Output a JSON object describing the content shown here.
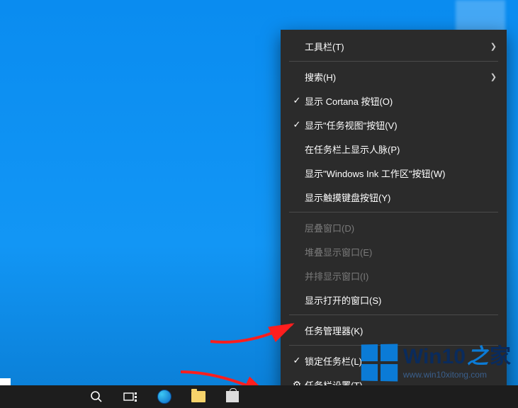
{
  "menu": {
    "items": [
      {
        "label": "工具栏(T)",
        "check": "",
        "hasSub": true,
        "disabled": false
      },
      {
        "sep": true
      },
      {
        "label": "搜索(H)",
        "check": "",
        "hasSub": true,
        "disabled": false
      },
      {
        "label": "显示 Cortana 按钮(O)",
        "check": "✓",
        "hasSub": false,
        "disabled": false
      },
      {
        "label": "显示\"任务视图\"按钮(V)",
        "check": "✓",
        "hasSub": false,
        "disabled": false
      },
      {
        "label": "在任务栏上显示人脉(P)",
        "check": "",
        "hasSub": false,
        "disabled": false
      },
      {
        "label": "显示\"Windows Ink 工作区\"按钮(W)",
        "check": "",
        "hasSub": false,
        "disabled": false
      },
      {
        "label": "显示触摸键盘按钮(Y)",
        "check": "",
        "hasSub": false,
        "disabled": false
      },
      {
        "sep": true
      },
      {
        "label": "层叠窗口(D)",
        "check": "",
        "hasSub": false,
        "disabled": true
      },
      {
        "label": "堆叠显示窗口(E)",
        "check": "",
        "hasSub": false,
        "disabled": true
      },
      {
        "label": "并排显示窗口(I)",
        "check": "",
        "hasSub": false,
        "disabled": true
      },
      {
        "label": "显示打开的窗口(S)",
        "check": "",
        "hasSub": false,
        "disabled": false
      },
      {
        "sep": true
      },
      {
        "label": "任务管理器(K)",
        "check": "",
        "hasSub": false,
        "disabled": false
      },
      {
        "sep": true
      },
      {
        "label": "锁定任务栏(L)",
        "check": "✓",
        "hasSub": false,
        "disabled": false
      },
      {
        "label": "任务栏设置(T)",
        "check": "⚙",
        "hasSub": false,
        "disabled": false,
        "gear": true
      }
    ]
  },
  "watermark": {
    "brand_main": "Win10",
    "brand_zhi": "之",
    "brand_jia": "家",
    "url": "www.win10xitong.com"
  }
}
